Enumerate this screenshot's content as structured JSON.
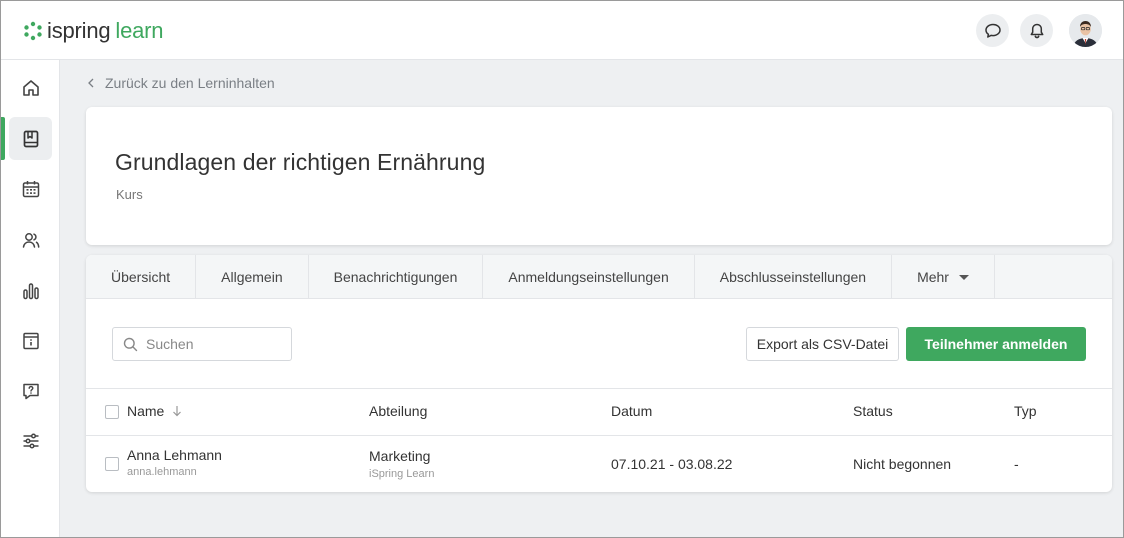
{
  "header": {
    "logo_part1": "ispring",
    "logo_part2": "learn",
    "chat_icon": "speech-bubble-icon",
    "bell_icon": "bell-icon",
    "accent_color": "#3fa85f"
  },
  "sidebar": {
    "items": [
      {
        "icon": "home-icon",
        "active": false
      },
      {
        "icon": "book-icon",
        "active": true
      },
      {
        "icon": "calendar-icon",
        "active": false
      },
      {
        "icon": "users-icon",
        "active": false
      },
      {
        "icon": "bar-chart-icon",
        "active": false
      },
      {
        "icon": "info-card-icon",
        "active": false
      },
      {
        "icon": "question-bubble-icon",
        "active": false
      },
      {
        "icon": "sliders-icon",
        "active": false
      }
    ]
  },
  "breadcrumb": {
    "back_label": "Zurück zu den Lerninhalten"
  },
  "course": {
    "title": "Grundlagen der richtigen Ernährung",
    "type": "Kurs"
  },
  "tabs": [
    {
      "label": "Übersicht"
    },
    {
      "label": "Allgemein"
    },
    {
      "label": "Benachrichtigungen"
    },
    {
      "label": "Anmeldungseinstellungen"
    },
    {
      "label": "Abschlusseinstellungen"
    },
    {
      "label": "Mehr"
    }
  ],
  "toolbar": {
    "search_placeholder": "Suchen",
    "export_label": "Export als CSV-Datei",
    "enroll_label": "Teilnehmer anmelden"
  },
  "table": {
    "columns": {
      "name": "Name",
      "department": "Abteilung",
      "date": "Datum",
      "status": "Status",
      "type": "Typ"
    },
    "rows": [
      {
        "name": "Anna Lehmann",
        "login": "anna.lehmann",
        "department": "Marketing",
        "department_sub": "iSpring Learn",
        "date": "07.10.21 - 03.08.22",
        "status": "Nicht begonnen",
        "type": "-"
      }
    ]
  }
}
